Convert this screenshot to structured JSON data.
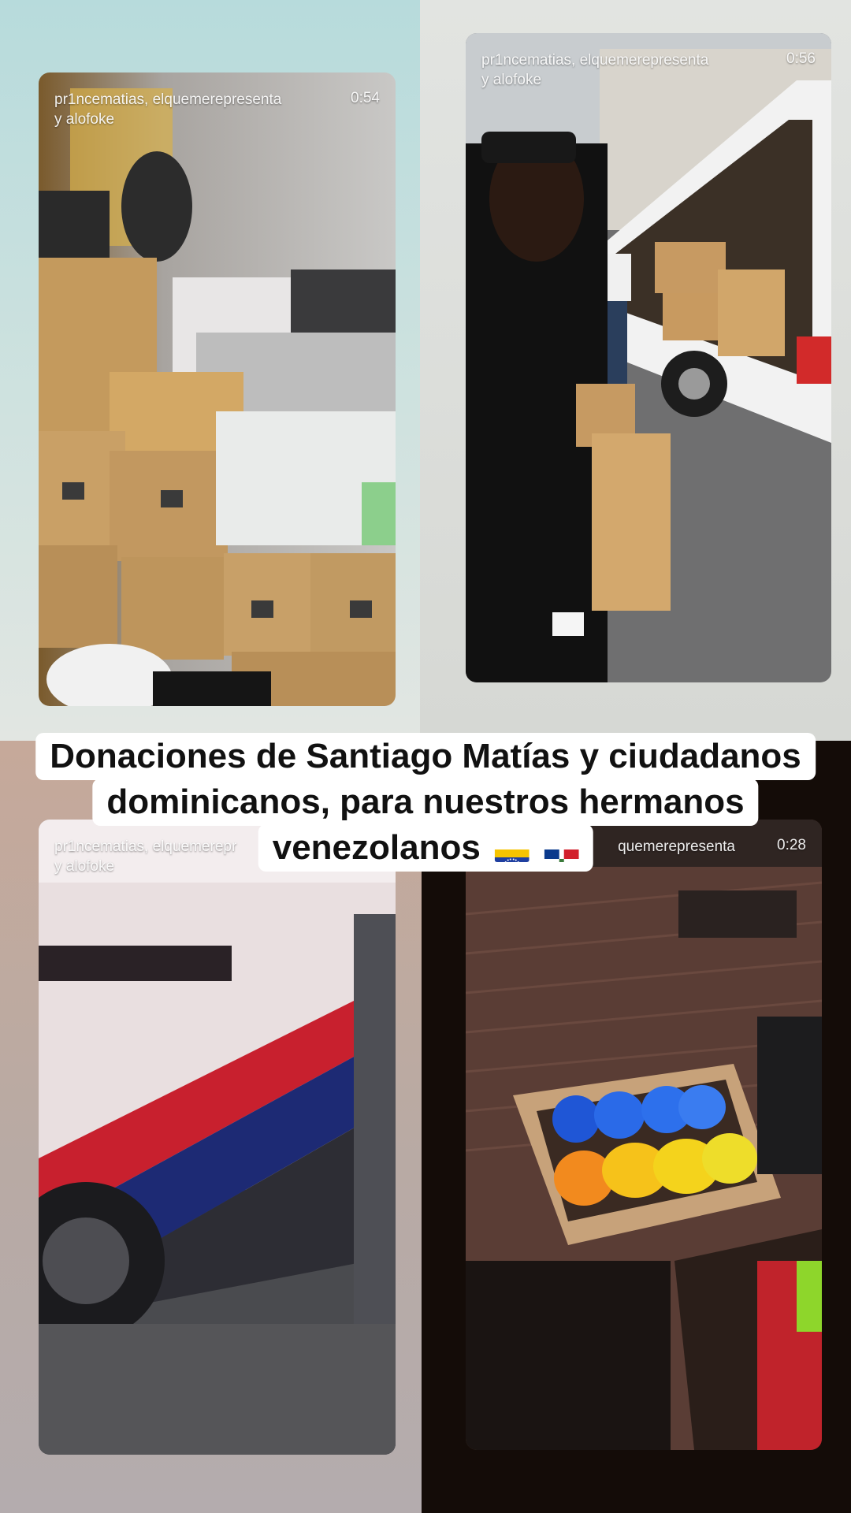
{
  "videos": [
    {
      "usernames": "pr1ncematias, elquemerepresenta\ny alofoke",
      "duration": "0:54"
    },
    {
      "usernames": "pr1ncematias, elquemerepresenta\ny alofoke",
      "duration": "0:56"
    },
    {
      "usernames": "pr1ncematias, elquemerepr\ny alofoke",
      "duration": ""
    },
    {
      "usernames": "quemerepresenta",
      "duration": "0:28"
    }
  ],
  "caption": {
    "line1": "Donaciones de Santiago Matías y ciudadanos",
    "line2": "dominicanos, para nuestros hermanos",
    "line3": "venezolanos",
    "flags": [
      "venezuela-flag",
      "dominican-republic-flag"
    ]
  },
  "colors": {
    "caption_bg": "#ffffff",
    "caption_text": "#111111",
    "overlay_text": "#ffffff"
  }
}
